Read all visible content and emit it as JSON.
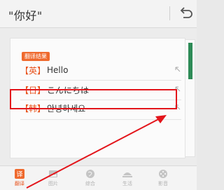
{
  "header": {
    "query": "\"你好\"",
    "back_icon": "undo-arrow-icon"
  },
  "result_card": {
    "badge": "翻译结果",
    "rows": [
      {
        "lang": "【英】",
        "text": "Hello",
        "icon": "expand-arrow-icon"
      },
      {
        "lang": "【日】",
        "text": "こんにちは",
        "icon": "expand-arrow-icon"
      },
      {
        "lang": "【韩】",
        "text": "안녕하세요",
        "icon": "expand-arrow-icon"
      }
    ]
  },
  "tabs": [
    {
      "label": "翻译",
      "icon": "translate-icon",
      "active": true
    },
    {
      "label": "图片",
      "icon": "image-icon",
      "active": false
    },
    {
      "label": "综合",
      "icon": "globe-icon",
      "active": false
    },
    {
      "label": "生活",
      "icon": "dining-icon",
      "active": false
    },
    {
      "label": "影音",
      "icon": "film-reel-icon",
      "active": false
    }
  ],
  "colors": {
    "accent": "#e8531d",
    "highlight": "#e3151b"
  }
}
